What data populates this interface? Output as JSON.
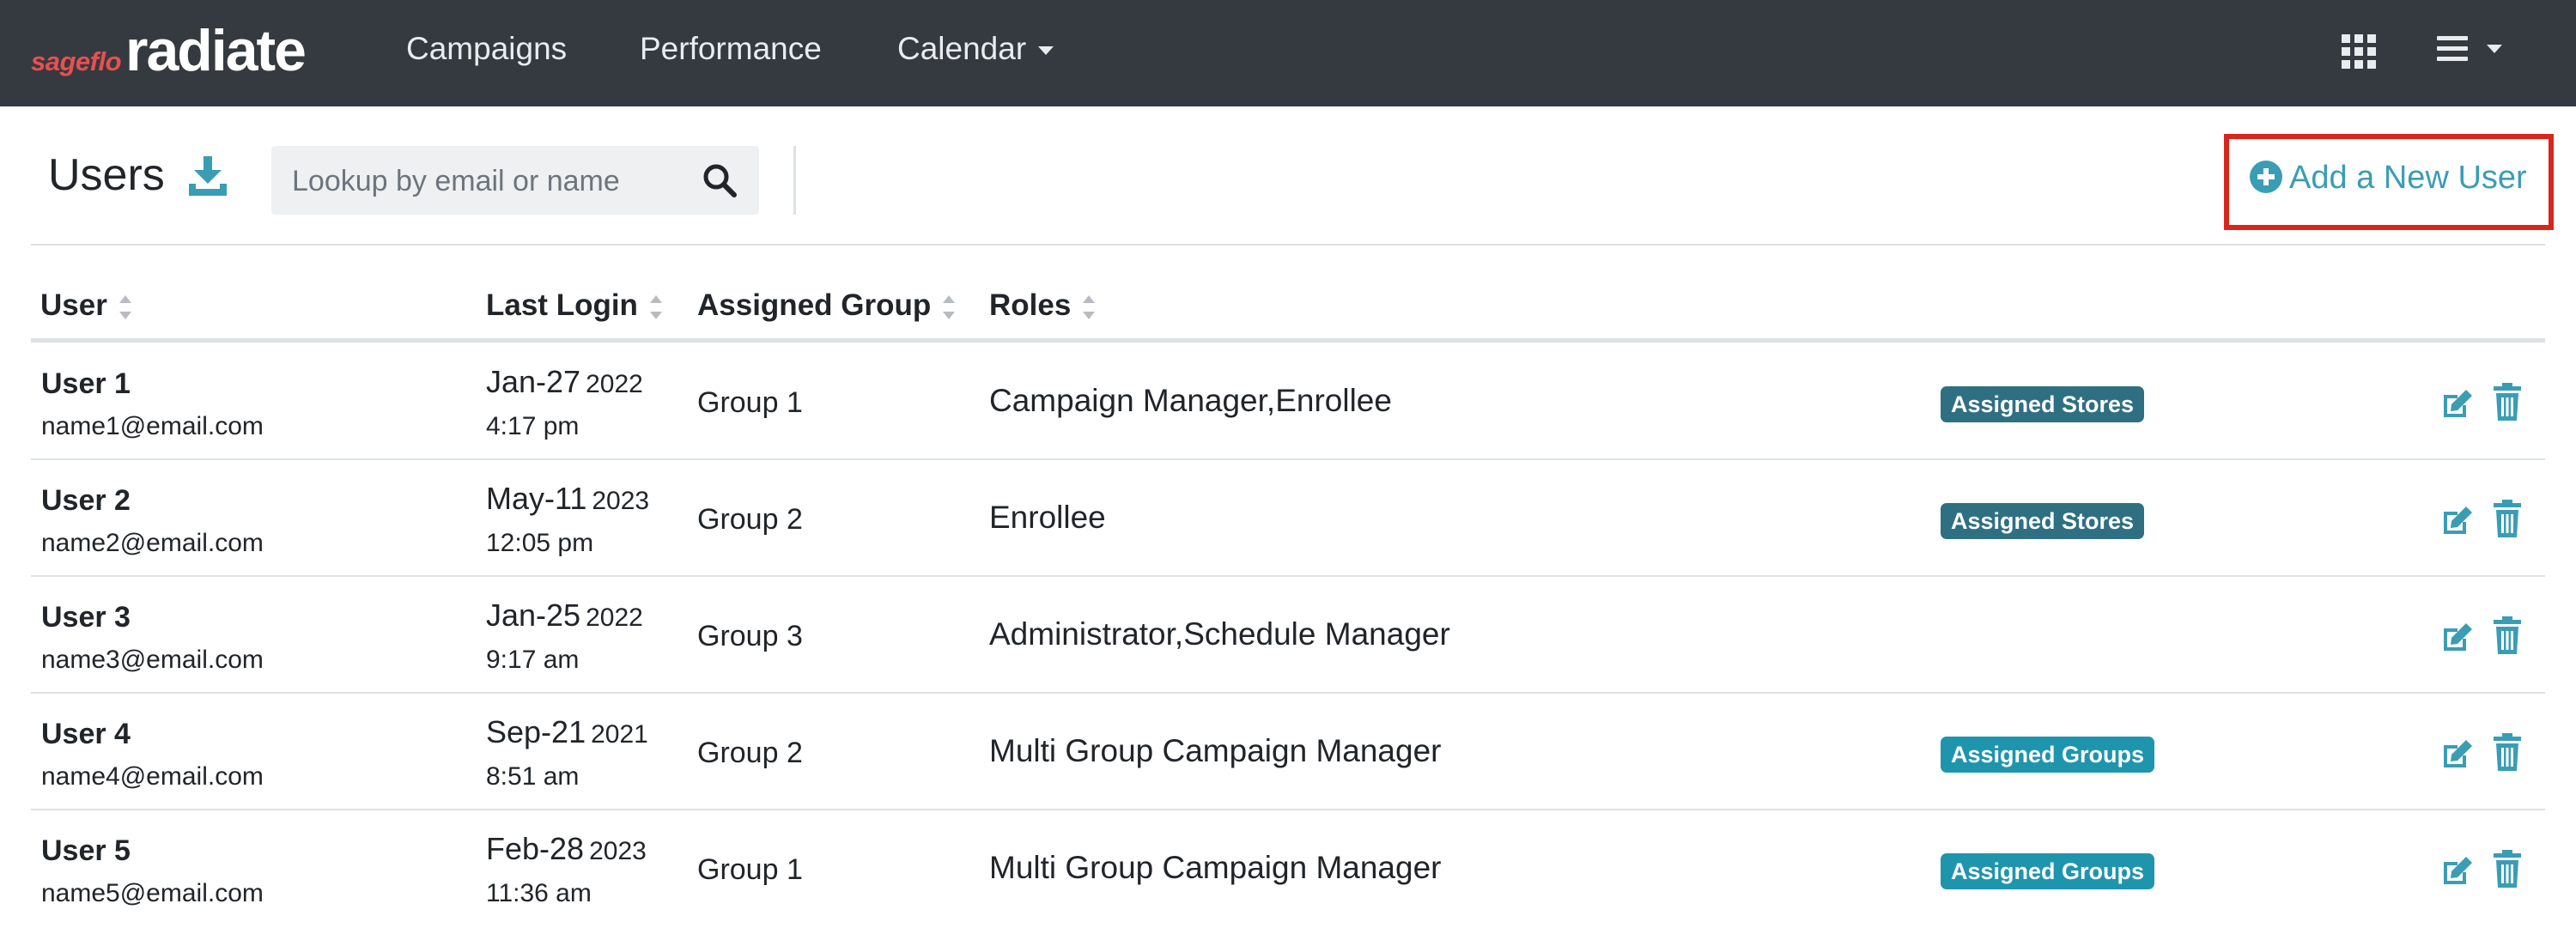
{
  "brand": {
    "prefix": "sageflo",
    "name": "radiate",
    "prefix_color": "#e8504f"
  },
  "nav": {
    "items": [
      {
        "label": "Campaigns"
      },
      {
        "label": "Performance"
      },
      {
        "label": "Calendar"
      }
    ],
    "apps_icon": "grid-icon",
    "menu_icon": "hamburger-icon"
  },
  "page": {
    "title": "Users",
    "download_icon": "download-icon",
    "search": {
      "placeholder": "Lookup by email or name",
      "value": ""
    },
    "add_button": {
      "label": "Add a New User",
      "icon": "plus-circle-icon"
    },
    "highlight_color": "#d9261c"
  },
  "table": {
    "columns": [
      "User",
      "Last Login",
      "Assigned Group",
      "Roles"
    ],
    "rows": [
      {
        "name": "User 1",
        "email": "name1@email.com",
        "date": "Jan-27",
        "year": "2022",
        "time": "4:17 pm",
        "group": "Group 1",
        "roles": "Campaign Manager,Enrollee",
        "badge": "Assigned Stores",
        "badge_color": "#2f6f82"
      },
      {
        "name": "User 2",
        "email": "name2@email.com",
        "date": "May-11",
        "year": "2023",
        "time": "12:05 pm",
        "group": "Group 2",
        "roles": "Enrollee",
        "badge": "Assigned Stores",
        "badge_color": "#2f6f82"
      },
      {
        "name": "User 3",
        "email": "name3@email.com",
        "date": "Jan-25",
        "year": "2022",
        "time": "9:17 am",
        "group": "Group 3",
        "roles": "Administrator,Schedule Manager",
        "badge": "",
        "badge_color": ""
      },
      {
        "name": "User 4",
        "email": "name4@email.com",
        "date": "Sep-21",
        "year": "2021",
        "time": "8:51 am",
        "group": "Group 2",
        "roles": "Multi Group Campaign Manager",
        "badge": "Assigned Groups",
        "badge_color": "#1f95ad"
      },
      {
        "name": "User 5",
        "email": "name5@email.com",
        "date": "Feb-28",
        "year": "2023",
        "time": "11:36 am",
        "group": "Group 1",
        "roles": "Multi Group Campaign Manager",
        "badge": "Assigned Groups",
        "badge_color": "#1f95ad"
      }
    ],
    "row_actions": {
      "edit_icon": "edit-icon",
      "delete_icon": "trash-icon",
      "icon_color": "#3a9db4"
    }
  }
}
